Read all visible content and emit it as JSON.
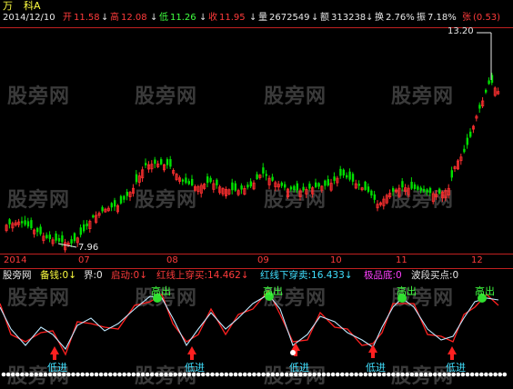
{
  "header": {
    "title": "万",
    "stock_name": "科A"
  },
  "info_bar": {
    "date": "2014/12/10",
    "open_label": "开",
    "open": "11.58",
    "high_label": "高",
    "high": "12.08",
    "low_label": "低",
    "low": "11.26",
    "close_label": "收",
    "close": "11.95",
    "volume_label": "量",
    "volume": "2672549",
    "amount_label": "额",
    "amount": "313238",
    "turnover_label": "换",
    "turnover": "2.76%",
    "amplitude_label": "振",
    "amplitude": "7.18%",
    "change_label": "张",
    "change": "(0.53)"
  },
  "price_chart": {
    "max_label": "13.20",
    "min_label": "7.96",
    "up_color": "#ff3030",
    "down_color": "#00e000"
  },
  "date_axis": [
    "2014",
    "07",
    "08",
    "09",
    "10",
    "11",
    "12"
  ],
  "indicator": {
    "name": "股旁网",
    "items": [
      {
        "label": "备钱:",
        "value": "0",
        "color": "#ffff40",
        "arrow": "↓"
      },
      {
        "label": "界:",
        "value": "0",
        "color": "#e8e8e8",
        "arrow": ""
      },
      {
        "label": "启动:",
        "value": "0",
        "color": "#ff3b3b",
        "arrow": "↓"
      },
      {
        "label": "红线上穿买:",
        "value": "14.462",
        "color": "#ff3b3b",
        "arrow": "↓"
      },
      {
        "label": "红线下穿卖:",
        "value": "16.433",
        "color": "#40e0ff",
        "arrow": "↓"
      },
      {
        "label": "极品底:",
        "value": "0",
        "color": "#ff40ff",
        "arrow": ""
      },
      {
        "label": "波段买点:",
        "value": "0",
        "color": "#e8e8e8",
        "arrow": ""
      }
    ],
    "sell_label": "高出",
    "buy_label": "低进"
  },
  "watermark": "股旁网"
}
